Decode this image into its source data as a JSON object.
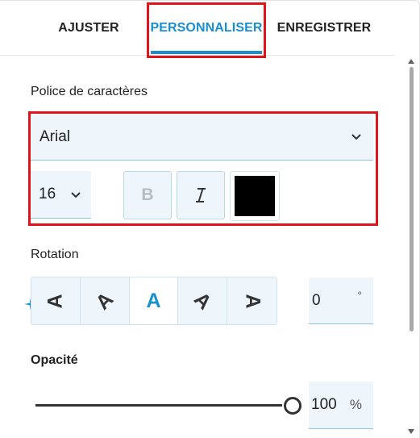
{
  "tabs": [
    {
      "label": "AJUSTER"
    },
    {
      "label": "PERSONNALISER"
    },
    {
      "label": "ENREGISTRER"
    }
  ],
  "active_tab": "PERSONNALISER",
  "font": {
    "section_label": "Police de caractères",
    "family": "Arial",
    "size": "16",
    "bold_label": "B",
    "italic_label": "I",
    "text_color": "#000000"
  },
  "rotation": {
    "section_label": "Rotation",
    "options": [
      "A",
      "A",
      "A",
      "A",
      "A"
    ],
    "selected_index": 2,
    "value": "0",
    "unit": "°"
  },
  "opacity": {
    "section_label": "Opacité",
    "value": "100",
    "unit": "%",
    "level_percent": 100
  },
  "colors": {
    "accent": "#1a8fd0",
    "highlight": "#e0151b"
  }
}
